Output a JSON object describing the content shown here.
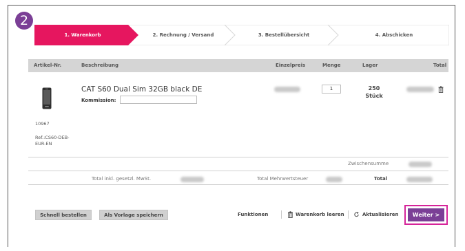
{
  "badge": "2",
  "steps": [
    {
      "label": "1. Warenkorb",
      "active": true
    },
    {
      "label": "2. Rechnung / Versand",
      "active": false
    },
    {
      "label": "3. Bestellübersicht",
      "active": false
    },
    {
      "label": "4. Abschicken",
      "active": false
    }
  ],
  "table": {
    "headers": {
      "artnr": "Artikel-Nr.",
      "desc": "Beschreibung",
      "unit_price": "Einzelpreis",
      "qty": "Menge",
      "stock": "Lager",
      "total": "Total"
    }
  },
  "item": {
    "name": "CAT S60 Dual Sim 32GB black DE",
    "komm_label": "Kommission:",
    "komm_value": "",
    "qty": "1",
    "stock_qty": "250",
    "stock_unit": "Stück",
    "art_nr": "10967",
    "ref": [
      "Ref.:CS60-DEB-",
      "EUR-EN"
    ]
  },
  "summary": {
    "subtotal_label": "Zwischensumme",
    "incl_vat_label": "Total inkl. gesetzl. MwSt.",
    "vat_label": "Total Mehrwertsteuer",
    "total_label": "Total"
  },
  "footer": {
    "quick_order": "Schnell bestellen",
    "save_template": "Als Vorlage speichern",
    "functions": "Funktionen",
    "clear_cart": "Warenkorb leeren",
    "refresh": "Aktualisieren",
    "next": "Weiter >"
  },
  "colors": {
    "accent": "#e6165f",
    "purple": "#7b3f96",
    "highlight": "#d6249a",
    "header_bg": "#d5d5d5"
  }
}
